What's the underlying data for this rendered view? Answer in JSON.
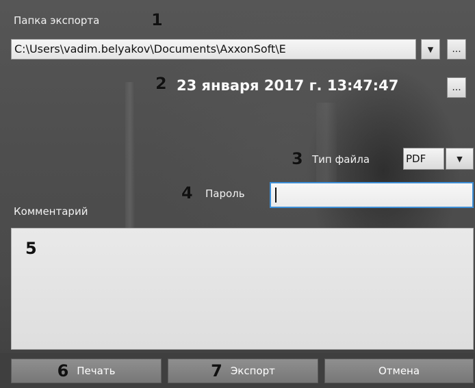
{
  "export_folder": {
    "label": "Папка экспорта",
    "path": "C:\\Users\\vadim.belyakov\\Documents\\AxxonSoft\\E",
    "dropdown_glyph": "▼",
    "browse_label": "..."
  },
  "datetime": {
    "value": "23 января 2017 г. 13:47:47",
    "browse_label": "..."
  },
  "file_type": {
    "label": "Тип файла",
    "value": "PDF",
    "dropdown_glyph": "▼"
  },
  "password": {
    "label": "Пароль",
    "value": ""
  },
  "comment": {
    "label": "Комментарий",
    "value": ""
  },
  "buttons": {
    "print": "Печать",
    "export": "Экспорт",
    "cancel": "Отмена"
  },
  "callouts": [
    "1",
    "2",
    "3",
    "4",
    "5",
    "6",
    "7"
  ]
}
